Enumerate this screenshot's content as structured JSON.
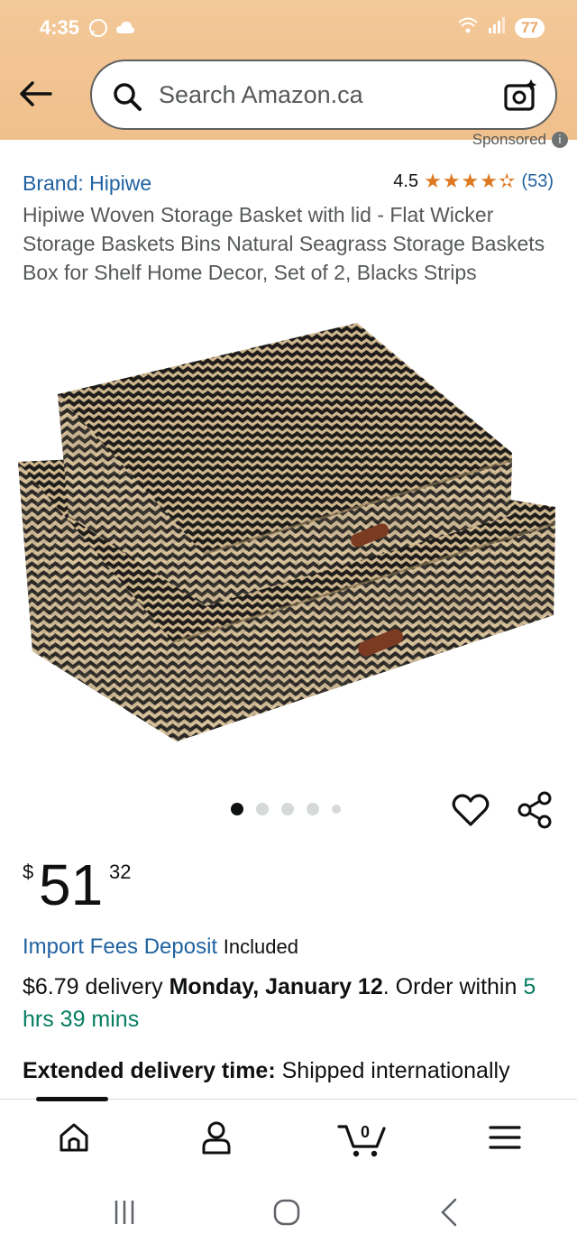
{
  "status_bar": {
    "time": "4:35",
    "battery": "77"
  },
  "search": {
    "placeholder": "Search Amazon.ca"
  },
  "sponsored_label": "Sponsored",
  "product": {
    "brand": "Brand: Hipiwe",
    "rating_value": "4.5",
    "rating_stars": 4.5,
    "stars_text": "★★★★✫",
    "review_count": "(53)",
    "title": "Hipiwe Woven Storage Basket with lid - Flat Wicker Storage Baskets Bins Natural Seagrass Storage Baskets Box for Shelf Home Decor, Set of 2, Blacks Strips"
  },
  "gallery": {
    "image_count": 5,
    "active_index": 0
  },
  "price": {
    "currency": "$",
    "whole": "51",
    "fraction": "32"
  },
  "import_fees": {
    "link": "Import Fees Deposit",
    "status": "Included"
  },
  "delivery": {
    "cost": "$6.79 delivery",
    "date": "Monday, January 12",
    "after_date": ". Order within",
    "countdown": "5 hrs 39 mins"
  },
  "extended": {
    "label": "Extended delivery time:",
    "text": "Shipped internationally"
  },
  "tabbar": {
    "cart_count": "0"
  },
  "colors": {
    "header": "#f0c08c",
    "link": "#2162a1",
    "stars": "#de7921",
    "countdown": "#067d62"
  }
}
